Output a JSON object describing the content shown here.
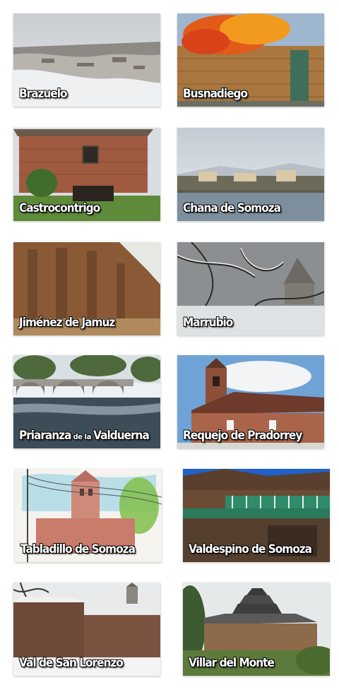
{
  "villages": [
    {
      "name": "Brazuelo"
    },
    {
      "name": "Busnadiego"
    },
    {
      "name": "Castrocontrigo"
    },
    {
      "name": "Chana de Somoza"
    },
    {
      "name": "Jiménez de Jamuz"
    },
    {
      "name": "Marrubio"
    },
    {
      "name_a": "Priaranza",
      "name_b": "de la",
      "name_c": "Valduerna"
    },
    {
      "name": "Requejo de Pradorrey"
    },
    {
      "name": "Tabladillo de Somoza"
    },
    {
      "name": "Valdespino de Somoza"
    },
    {
      "name": "Val de San Lorenzo"
    },
    {
      "name": "Villar del Monte"
    }
  ]
}
